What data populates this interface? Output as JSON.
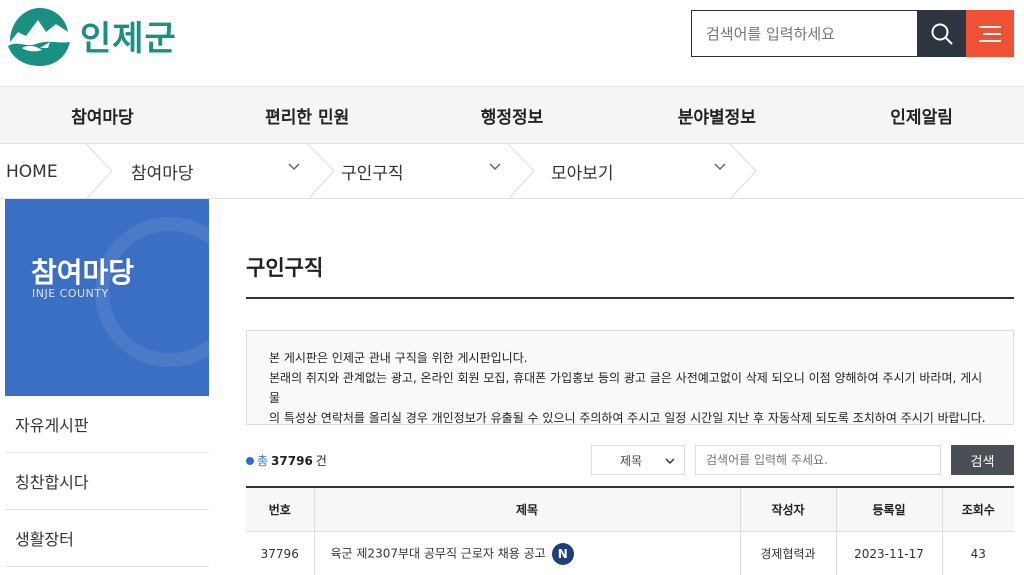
{
  "header": {
    "logo_text": "인제군",
    "search_placeholder": "검색어를 입력하세요",
    "search_icon": "search-icon",
    "menu_icon": "hamburger-menu-icon"
  },
  "gnb": {
    "items": [
      "참여마당",
      "편리한 민원",
      "행정정보",
      "분야별정보",
      "인제알림"
    ]
  },
  "breadcrumb": {
    "home": "HOME",
    "level1": "참여마당",
    "level2": "구인구직",
    "level3": "모아보기"
  },
  "sidebar": {
    "title": "참여마당",
    "subtitle": "INJE COUNTY",
    "items": [
      "자유게시판",
      "칭찬합시다",
      "생활장터"
    ]
  },
  "content": {
    "page_title": "구인구직",
    "notice_lines": [
      "본 게시판은 인제군 관내 구직을 위한 게시판입니다.",
      "본래의 취지와 관계없는 광고, 온라인 회원 모집, 휴대폰 가입홍보 등의 광고 글은 사전예고없이 삭제 되오니 이점 양해하여 주시기 바라며, 게시물",
      "의 특성상 연락처를 올리실 경우 개인정보가 유출될 수 있으니 주의하여 주시고 일정 시간일 지난 후 자동삭제 되도록 조치하여 주시기 바랍니다."
    ],
    "total_label": "총",
    "total_count": "37796",
    "total_unit": "건",
    "filter_selected": "제목",
    "search_placeholder": "검색어를 입력해 주세요.",
    "search_button": "검색"
  },
  "table": {
    "headers": [
      "번호",
      "제목",
      "작성자",
      "등록일",
      "조회수"
    ],
    "rows": [
      {
        "no": "37796",
        "title": "육군 제2307부대 공무직 근로자 채용 공고",
        "badge": "N",
        "author": "경제협력과",
        "date": "2023-11-17",
        "views": "43"
      }
    ]
  },
  "colors": {
    "brand": "#1a8f84",
    "side_blue": "#3b6fc4",
    "search_btn": "#2c3540",
    "menu_btn": "#ee5133",
    "new_badge": "#1f3f7a"
  }
}
